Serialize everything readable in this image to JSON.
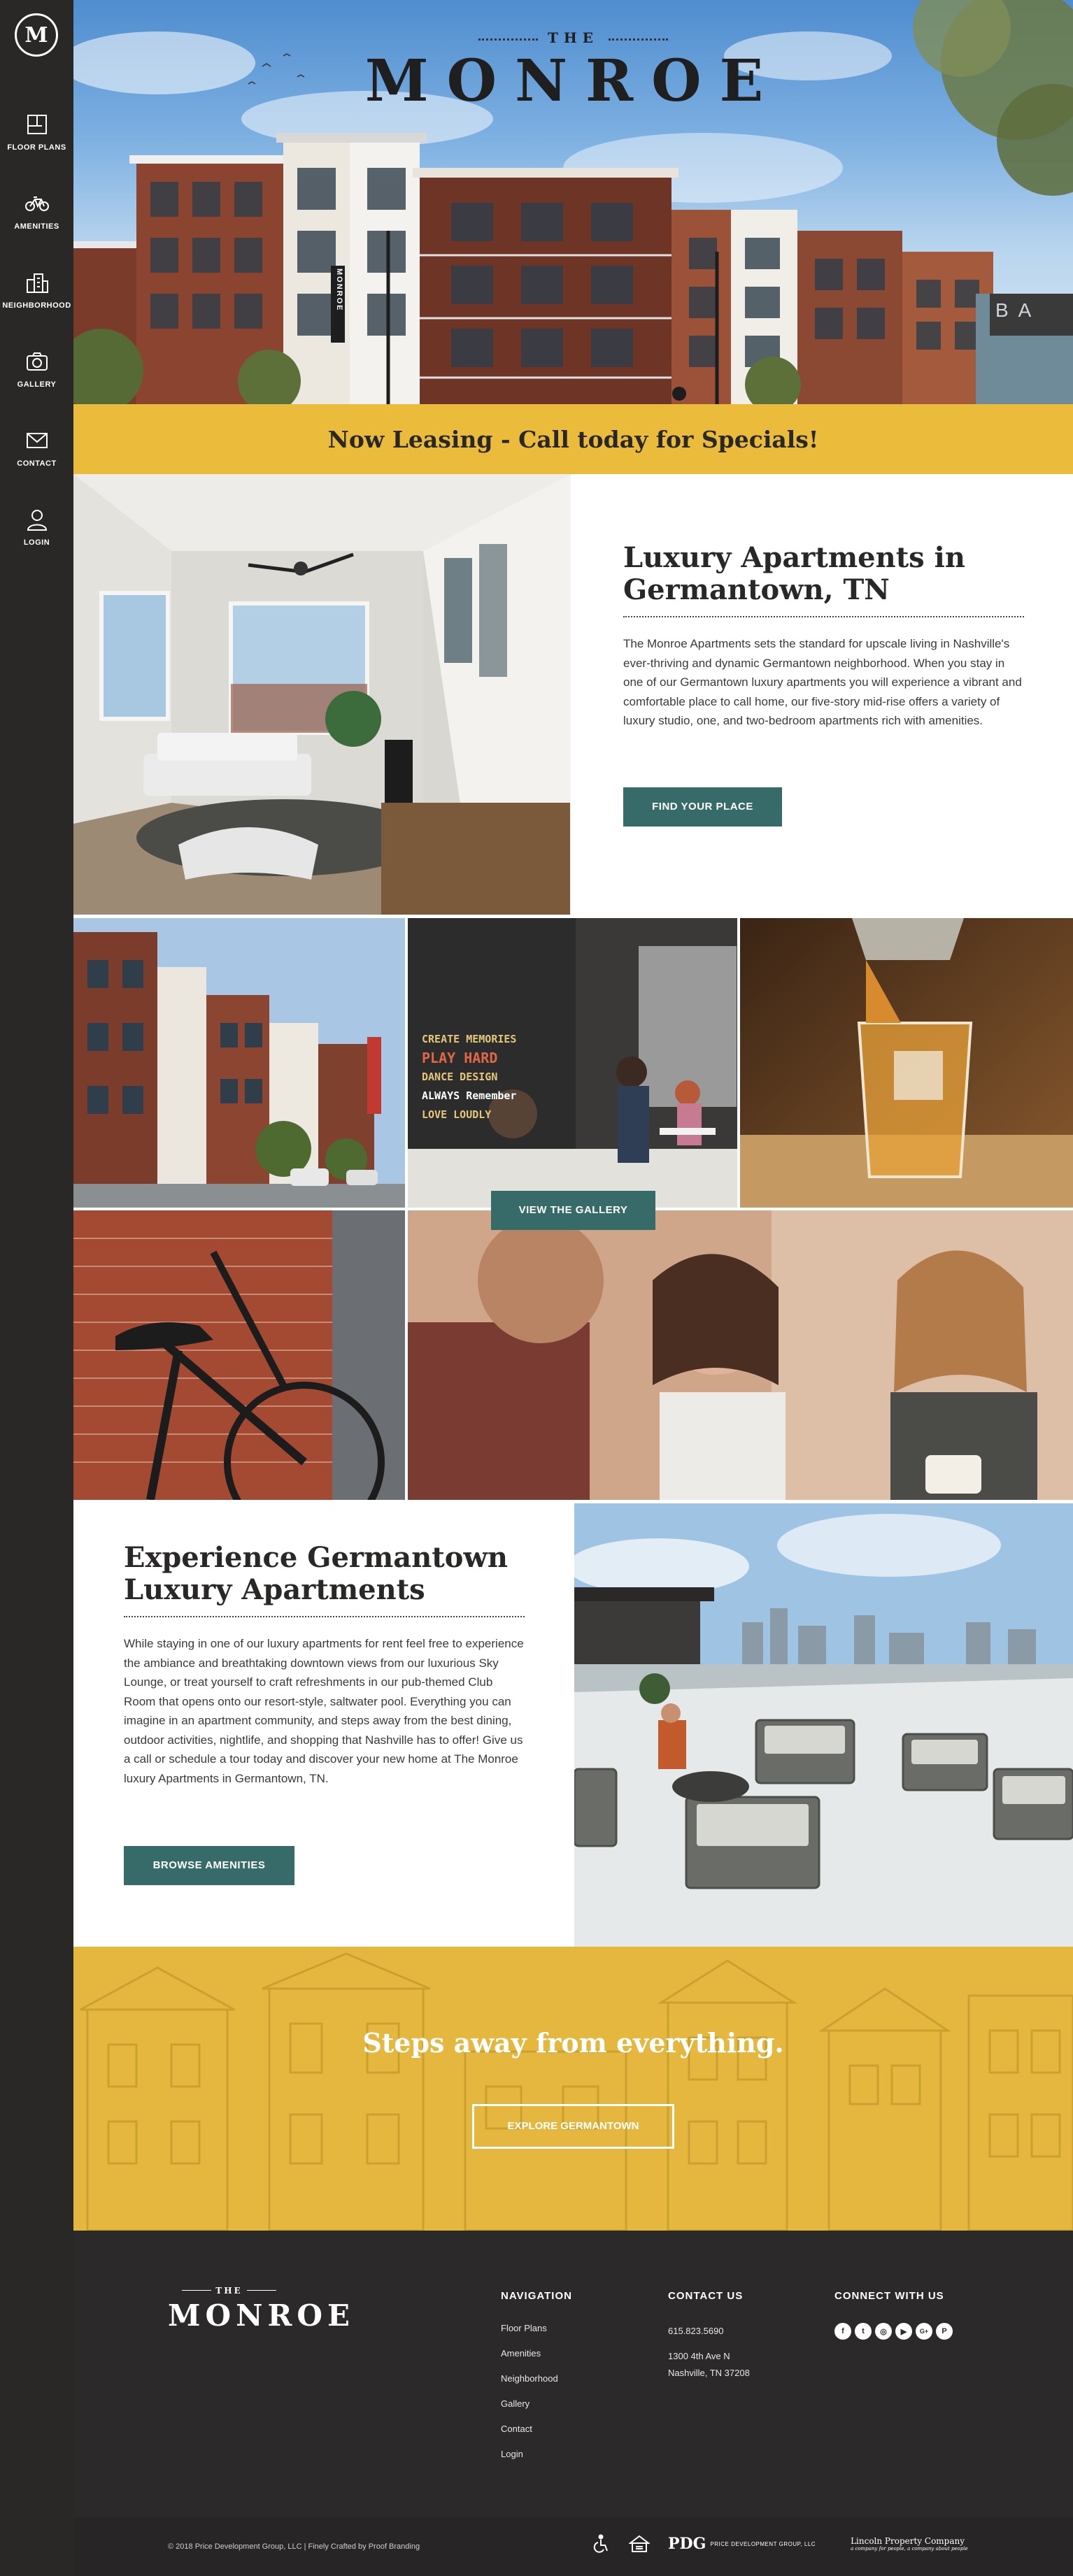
{
  "sidebar": {
    "logo_letter": "M",
    "items": [
      {
        "label": "FLOOR PLANS"
      },
      {
        "label": "AMENITIES"
      },
      {
        "label": "NEIGHBORHOOD"
      },
      {
        "label": "GALLERY"
      },
      {
        "label": "CONTACT"
      },
      {
        "label": "LOGIN"
      }
    ]
  },
  "hero": {
    "the": "THE",
    "brand": "MONROE",
    "building_sign": "MONROE",
    "side_sign": "BA"
  },
  "banner": {
    "text": "Now Leasing - Call today for Specials!"
  },
  "intro": {
    "title": "Luxury Apartments in Germantown, TN",
    "body": "The Monroe Apartments sets the standard for upscale living in Nashville's ever-thriving and dynamic Germantown neighborhood. When you stay in one of our Germantown luxury apartments you will experience a vibrant and comfortable place to call home, our five-story mid-rise offers a variety of luxury studio, one, and two-bedroom apartments rich with amenities.",
    "button": "FIND YOUR PLACE"
  },
  "gallery": {
    "button": "VIEW THE GALLERY",
    "chalkboard_lines": [
      "CREATE MEMORIES",
      "PLAY HARD",
      "DANCE DESIGN",
      "ALWAYS Remember",
      "LOVE LOUDLY"
    ]
  },
  "experience": {
    "title": "Experience Germantown Luxury Apartments",
    "body": "While staying in one of our luxury apartments for rent feel free to experience the ambiance and breathtaking downtown views from our luxurious Sky Lounge, or treat yourself to craft refreshments in our pub-themed Club Room that opens onto our resort-style, saltwater pool. Everything you can imagine in an apartment community, and steps away from the best dining, outdoor activities, nightlife, and shopping that Nashville has to offer! Give us a call or schedule a tour today and discover your new home at The Monroe luxury Apartments in Germantown, TN.",
    "button": "BROWSE AMENITIES"
  },
  "explore": {
    "heading": "Steps away from everything.",
    "button": "EXPLORE GERMANTOWN"
  },
  "footer": {
    "logo_the": "THE",
    "logo_brand": "MONROE",
    "nav_heading": "NAVIGATION",
    "nav_links": [
      "Floor Plans",
      "Amenities",
      "Neighborhood",
      "Gallery",
      "Contact",
      "Login"
    ],
    "contact_heading": "CONTACT US",
    "phone": "615.823.5690",
    "address_line1": "1300 4th Ave N",
    "address_line2": "Nashville, TN 37208",
    "connect_heading": "CONNECT WITH US",
    "social": [
      {
        "icon": "facebook-icon",
        "glyph": "f"
      },
      {
        "icon": "twitter-icon",
        "glyph": "t"
      },
      {
        "icon": "instagram-icon",
        "glyph": "◎"
      },
      {
        "icon": "youtube-icon",
        "glyph": "▶"
      },
      {
        "icon": "googleplus-icon",
        "glyph": "G+"
      },
      {
        "icon": "pinterest-icon",
        "glyph": "P"
      }
    ],
    "copyright": "© 2018 Price Development Group, LLC | Finely Crafted by Proof Branding",
    "price_dev": "PRICE DEVELOPMENT GROUP, LLC",
    "lpc_name": "Lincoln Property Company",
    "lpc_tagline": "a company for people, a company about people",
    "pdg_mark": "PDG"
  },
  "colors": {
    "sidebar": "#2a2727",
    "gold": "#ebbc3b",
    "teal": "#366b69",
    "footer": "#2b2929"
  }
}
